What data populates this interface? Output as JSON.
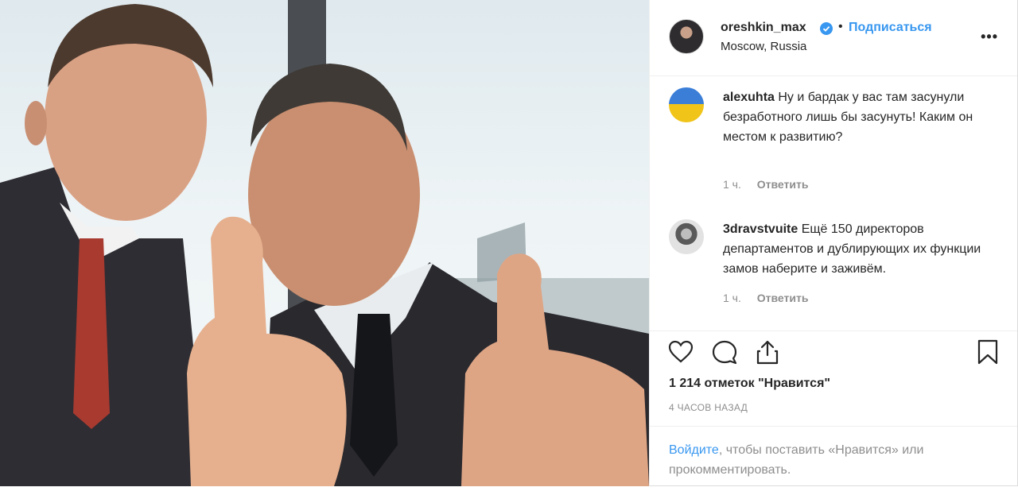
{
  "post": {
    "photo_alt": "",
    "owner": {
      "username": "oreshkin_max",
      "verified": true,
      "separator": "•",
      "follow_label": "Подписаться",
      "location": "Moscow, Russia",
      "more_label": "•••"
    },
    "comments": [
      {
        "username": "alexuhta",
        "text": "Ну и бардак у вас там засунули безработного лишь бы засунуть! Каким он местом к развитию?",
        "time": "1 ч.",
        "reply_label": "Ответить"
      },
      {
        "username": "3dravstvuite",
        "text": "Ещё 150 директоров департаментов и дублирующих их функции замов наберите и заживём.",
        "time": "1 ч.",
        "reply_label": "Ответить"
      }
    ],
    "actions": {
      "icons": [
        "heart-icon",
        "comment-icon",
        "share-icon",
        "bookmark-icon"
      ]
    },
    "likes_text": "1 214 отметок \"Нравится\"",
    "timestamp": "4 ЧАСОВ НАЗАД",
    "login_prompt": {
      "link_text": "Войдите",
      "rest_text": ", чтобы поставить «Нравится» или прокомментировать."
    },
    "colors": {
      "accent": "#3897f0",
      "muted": "#8e8e8e",
      "text": "#262626"
    }
  }
}
